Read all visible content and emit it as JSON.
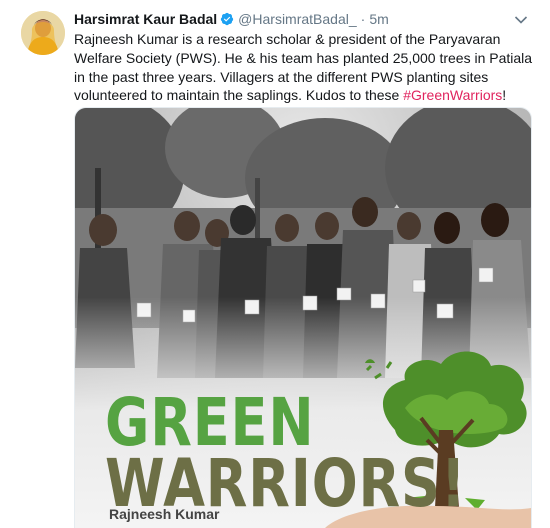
{
  "tweet": {
    "author_name": "Harsimrat Kaur Badal",
    "handle": "@HarsimratBadal_",
    "separator": "·",
    "time": "5m",
    "text_main": "Rajneesh Kumar is a  research scholar & president of the Paryavaran Welfare Society (PWS). He & his team has planted 25,000 trees in Patiala in the past three years. Villagers at the different PWS planting sites volunteered to maintain the saplings. Kudos to these ",
    "hashtag": "#GreenWarriors",
    "text_end": "!"
  },
  "media": {
    "headline_line1": "GREEN",
    "headline_line2": "WARRIORS!",
    "caption": "Rajneesh Kumar"
  },
  "colors": {
    "verified": "#1da1f2",
    "hashtag": "#e0245e",
    "green_text": "#56a342",
    "olive_text": "#6d6f46"
  },
  "icons": {
    "verified": "verified-badge-icon",
    "caret": "chevron-down-icon"
  }
}
